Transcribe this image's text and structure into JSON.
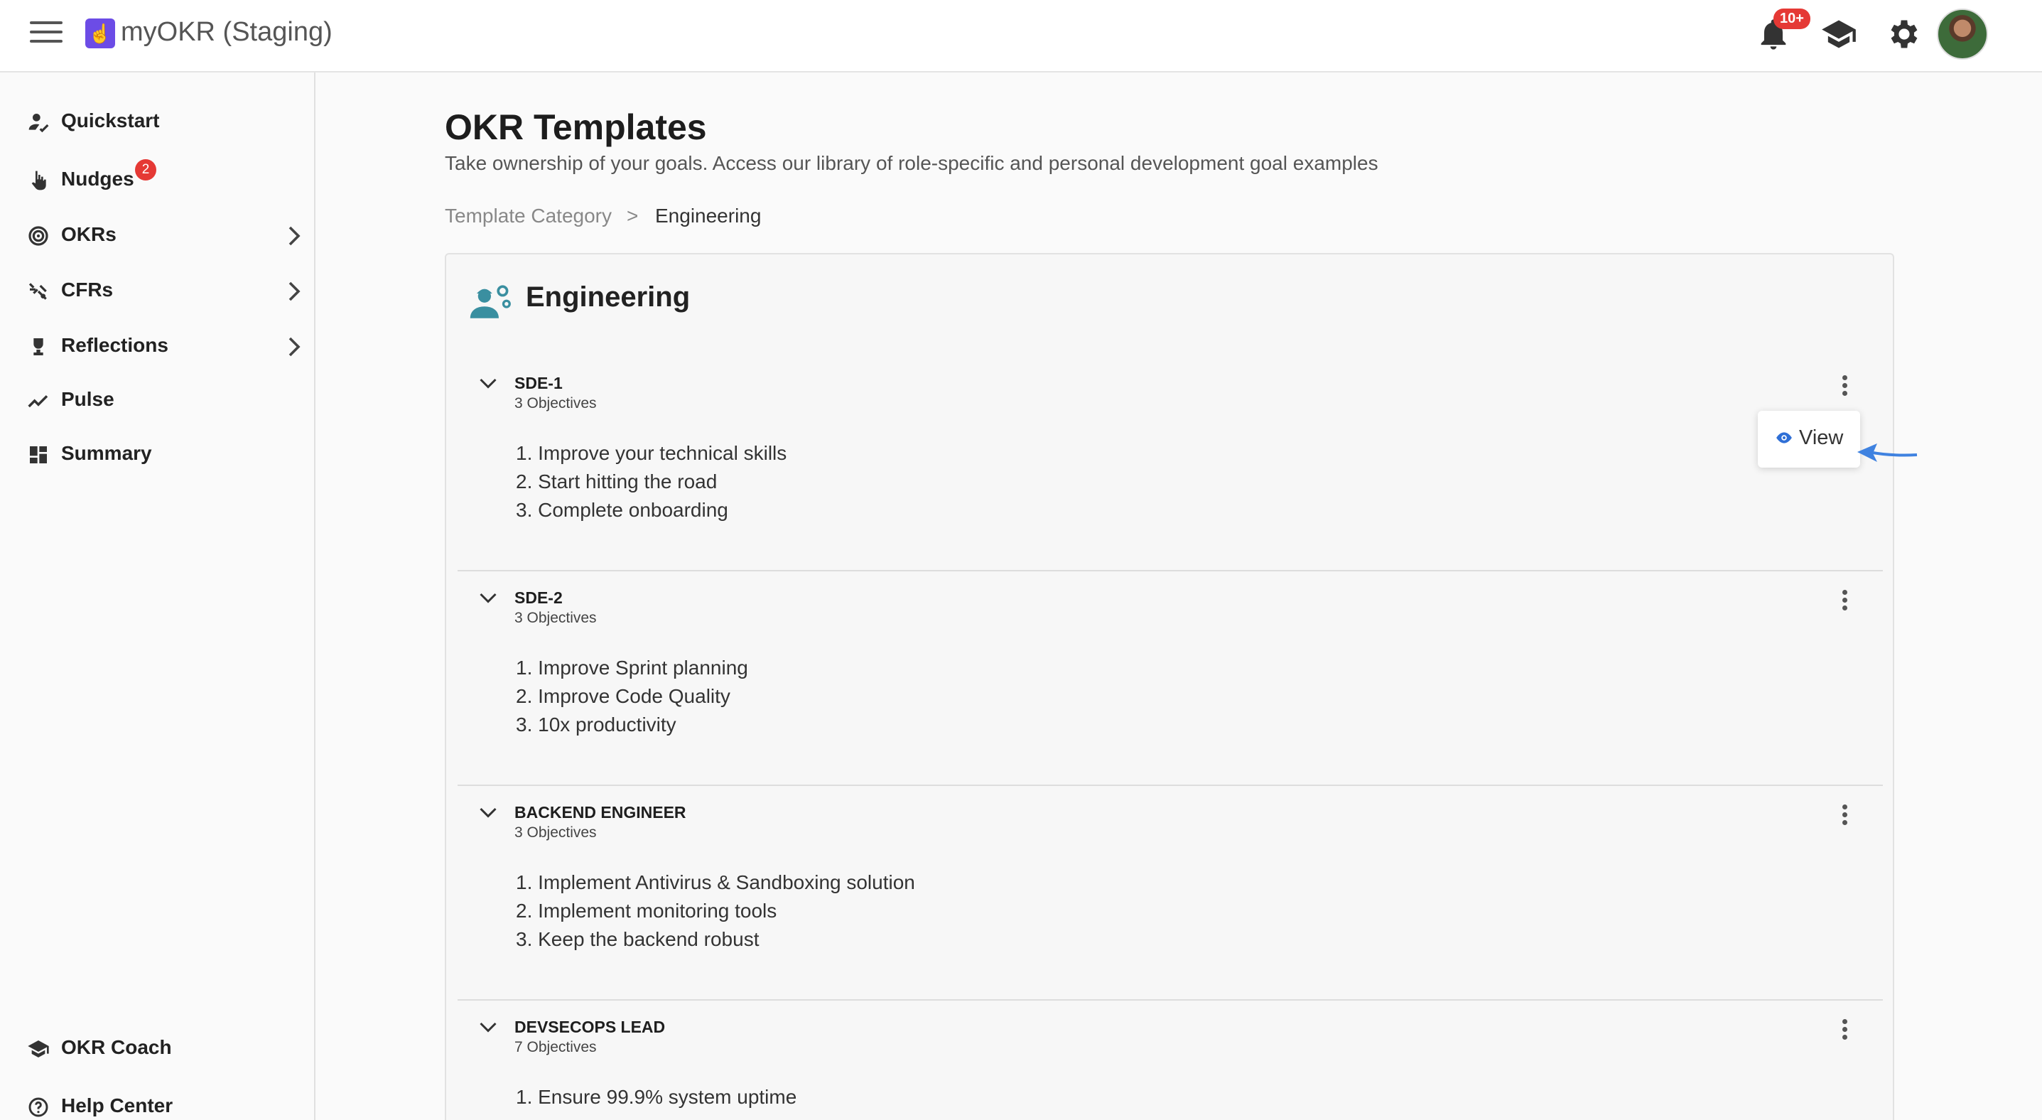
{
  "header": {
    "app_title": "myOKR (Staging)",
    "notification_badge": "10+",
    "icons": [
      "menu-icon",
      "app-logo-icon",
      "bell-icon",
      "graduation-cap-icon",
      "gear-icon",
      "avatar"
    ]
  },
  "sidebar": {
    "items": [
      {
        "label": "Quickstart",
        "icon": "quickstart-icon"
      },
      {
        "label": "Nudges",
        "icon": "hand-pointer-icon",
        "badge": "2"
      },
      {
        "label": "OKRs",
        "icon": "target-icon",
        "has_submenu": true
      },
      {
        "label": "CFRs",
        "icon": "cfrs-icon",
        "has_submenu": true
      },
      {
        "label": "Reflections",
        "icon": "trophy-icon",
        "has_submenu": true
      },
      {
        "label": "Pulse",
        "icon": "trend-icon"
      },
      {
        "label": "Summary",
        "icon": "dashboard-icon"
      }
    ],
    "bottom_items": [
      {
        "label": "OKR Coach",
        "icon": "graduation-cap-icon"
      },
      {
        "label": "Help Center",
        "icon": "help-icon"
      }
    ]
  },
  "main": {
    "title": "OKR Templates",
    "subtitle": "Take ownership of your goals. Access our library of role-specific and personal development goal examples",
    "breadcrumb": {
      "parent": "Template Category",
      "separator": ">",
      "current": "Engineering"
    },
    "category": {
      "title": "Engineering",
      "icon": "engineer-gear-icon"
    },
    "templates": [
      {
        "name": "SDE-1",
        "count": "3 Objectives",
        "objectives": [
          "1. Improve your technical skills",
          "2. Start hitting the road",
          "3. Complete onboarding"
        ]
      },
      {
        "name": "SDE-2",
        "count": "3 Objectives",
        "objectives": [
          "1. Improve Sprint planning",
          "2. Improve Code Quality",
          "3. 10x productivity"
        ]
      },
      {
        "name": "BACKEND ENGINEER",
        "count": "3 Objectives",
        "objectives": [
          "1. Implement Antivirus & Sandboxing solution",
          "2. Implement monitoring tools",
          "3. Keep the backend robust"
        ]
      },
      {
        "name": "DEVSECOPS LEAD",
        "count": "7 Objectives",
        "objectives": [
          "1. Ensure 99.9% system uptime"
        ]
      }
    ],
    "menu_popup": {
      "label": "View",
      "icon": "eye-icon"
    }
  },
  "colors": {
    "accent": "#6c4ce6",
    "badge": "#e53935",
    "engineer_icon": "#3a8fa0",
    "link_blue": "#2f6fd6",
    "annotation_arrow": "#3f82e0"
  }
}
